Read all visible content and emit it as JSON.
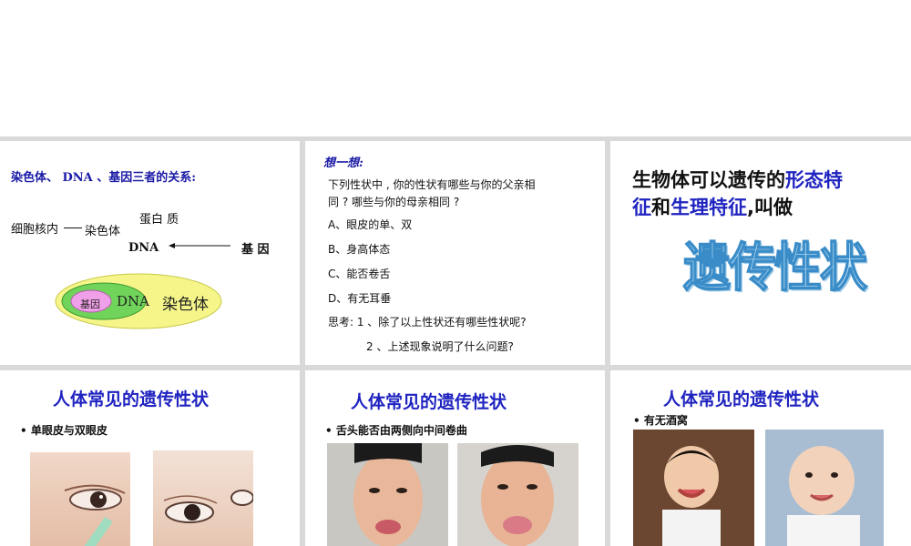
{
  "slide1": {
    "heading": "染色体、 DNA 、基因三者的关系:",
    "cell_nucleus": "细胞核内",
    "chromosome": "染色体",
    "protein": "蛋白  质",
    "dna": "DNA",
    "gene": "基  因",
    "diagram_gene": "基因",
    "diagram_dna": "DNA",
    "diagram_chromosome": "染色体"
  },
  "slide2": {
    "heading": "想一想:",
    "question_line1": "下列性状中 , 你的性状有哪些与你的父亲相",
    "question_line2": "同 ? 哪些与你的母亲相同  ?",
    "options": [
      "A、眼皮的单、双",
      "B、身高体态",
      "C、能否卷舌",
      "D、有无耳垂"
    ],
    "think_line1": "思考:  1 、除了以上性状还有哪些性状呢?",
    "think_line2": "2 、上述现象说明了什么问题?"
  },
  "slide3": {
    "text_a": "生物体可以遗传的",
    "text_b": "形态特",
    "text_c": "征",
    "text_d": "和",
    "text_e": "生理特征",
    "text_f": ",叫做",
    "wordart": "遗传性状"
  },
  "slide4": {
    "title": "人体常见的遗传性状",
    "bullet": "• 单眼皮与双眼皮"
  },
  "slide5": {
    "title": "人体常见的遗传性状",
    "bullet": "• 舌头能否由两侧向中间卷曲"
  },
  "slide6": {
    "title": "人体常见的遗传性状",
    "bullet": "• 有无酒窝"
  }
}
